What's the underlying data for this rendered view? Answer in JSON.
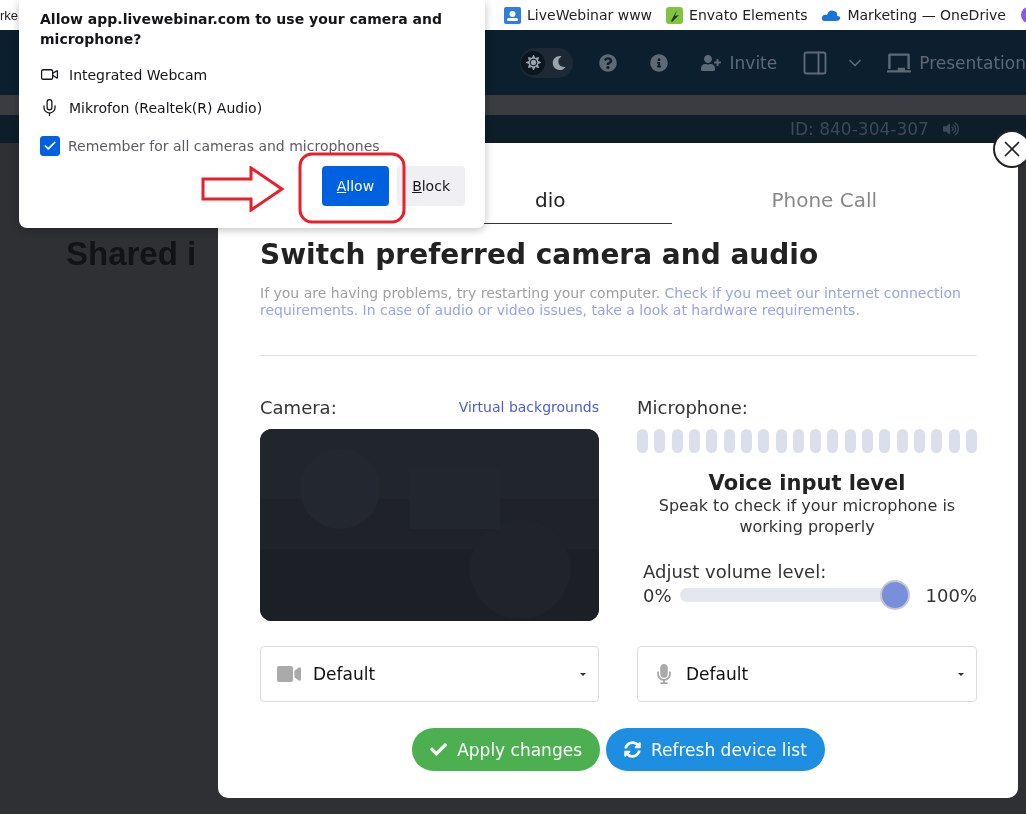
{
  "browser": {
    "bookmarks": [
      {
        "kind": "none",
        "label": "rke"
      },
      {
        "kind": "webinar",
        "label": "LiveWebinar www"
      },
      {
        "kind": "leaf",
        "label": "Envato Elements"
      },
      {
        "kind": "cloud",
        "label": "Marketing — OneDrive"
      },
      {
        "kind": "circle"
      }
    ]
  },
  "header": {
    "theme_dark": false,
    "invite": "Invite",
    "presentation": "Presentation"
  },
  "session": {
    "id": "ID: 840-304-307"
  },
  "stage": {
    "heading": "Shared i"
  },
  "dialog": {
    "tabs": [
      {
        "label": "dio",
        "selected": true
      },
      {
        "label": "Phone Call",
        "selected": false
      }
    ],
    "title": "Switch preferred camera and audio",
    "intro": "If you are having problems, try restarting your computer.",
    "intro_link_lines": [
      "Check if you meet our internet connection",
      "requirements. In case of audio or video issues, take a look at hardware requirements."
    ],
    "camera": {
      "label": "Camera:",
      "link": "Virtual backgrounds",
      "device": "Default"
    },
    "microphone": {
      "label": "Microphone:",
      "meter_title": "Voice input level",
      "meter_hint": "Speak to check if your microphone is working properly",
      "volume_label": "Adjust volume level:",
      "min": "0%",
      "volume": {
        "level": 1
      },
      "max": "100%",
      "device": "Default"
    },
    "buttons": [
      {
        "kind": "apply",
        "label": "Apply changes"
      },
      {
        "kind": "refresh",
        "label": "Refresh device list"
      }
    ]
  },
  "permission": {
    "title": "Allow app.livewebinar.com to use your camera and microphone?",
    "devices": [
      {
        "kind": "camera",
        "label": "Integrated Webcam"
      },
      {
        "kind": "microphone",
        "label": "Mikrofon (Realtek(R) Audio)"
      }
    ],
    "remember": {
      "label": "Remember for all cameras and microphones",
      "checked": true
    },
    "allow": "Allow",
    "block": "Block"
  }
}
